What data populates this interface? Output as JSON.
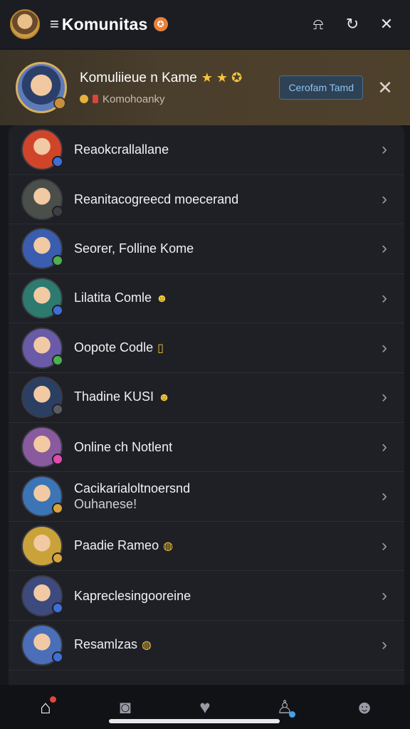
{
  "header": {
    "menu_glyph": "≡",
    "title": "Komunitas",
    "badge": "✪",
    "actions": [
      {
        "icon": "bell-icon",
        "glyph": "⍾"
      },
      {
        "icon": "refresh-icon",
        "glyph": "↻"
      },
      {
        "icon": "close-icon",
        "glyph": "✕"
      }
    ]
  },
  "banner": {
    "title": "Komuliieue n Kame",
    "stars": "★ ★ ✪",
    "subtitle": "Komohoanky",
    "button_label": "Cerofam Tamd",
    "close_glyph": "✕"
  },
  "list": {
    "items": [
      {
        "label": "Reaokcrallallane",
        "line2": "",
        "emoji": "",
        "avatar_color": "#d0452a",
        "ind_color": "#3f6fd6"
      },
      {
        "label": "Reanitacogreecd moecerand",
        "line2": "",
        "emoji": "",
        "avatar_color": "#4a4f4a",
        "ind_color": "#3e3f45"
      },
      {
        "label": "Seorer, Folline Kome",
        "line2": "",
        "emoji": "",
        "avatar_color": "#3a5db0",
        "ind_color": "#4bb04f"
      },
      {
        "label": "Lilatita Comle",
        "line2": "",
        "emoji": "☻",
        "avatar_color": "#2d7a6e",
        "ind_color": "#3f6fd6"
      },
      {
        "label": "Oopote Codle",
        "line2": "",
        "emoji": "▯",
        "avatar_color": "#6a5aa8",
        "ind_color": "#4bb04f"
      },
      {
        "label": "Thadine KUSI",
        "line2": "",
        "emoji": "☻",
        "avatar_color": "#2b3f62",
        "ind_color": "#5a5b63"
      },
      {
        "label": "Online ch Notlent",
        "line2": "",
        "emoji": "",
        "avatar_color": "#8a5a9e",
        "ind_color": "#e24ab0"
      },
      {
        "label": "Cacikarialoltnoersnd",
        "line2": "Ouhanese!",
        "emoji": "",
        "avatar_color": "#3b75b5",
        "ind_color": "#d8a53a"
      },
      {
        "label": "Paadie Rameo",
        "line2": "",
        "emoji": "◍",
        "avatar_color": "#c9a33a",
        "ind_color": "#d8a53a"
      },
      {
        "label": "Kapreclesingooreine",
        "line2": "",
        "emoji": "",
        "avatar_color": "#3d4a7e",
        "ind_color": "#3f6fd6"
      },
      {
        "label": "Resamlzas",
        "line2": "",
        "emoji": "◍",
        "avatar_color": "#4a6fb8",
        "ind_color": "#3f6fd6"
      }
    ],
    "chevron": "›"
  },
  "bottom_nav": [
    {
      "name": "home-icon",
      "glyph": "⌂",
      "active": true,
      "dot": "red"
    },
    {
      "name": "camera-icon",
      "glyph": "◙",
      "active": false,
      "dot": ""
    },
    {
      "name": "heart-icon",
      "glyph": "♥",
      "active": false,
      "dot": ""
    },
    {
      "name": "profile-icon",
      "glyph": "♙",
      "active": false,
      "dot": "blue"
    },
    {
      "name": "avatar-icon",
      "glyph": "☻",
      "active": false,
      "dot": ""
    }
  ]
}
